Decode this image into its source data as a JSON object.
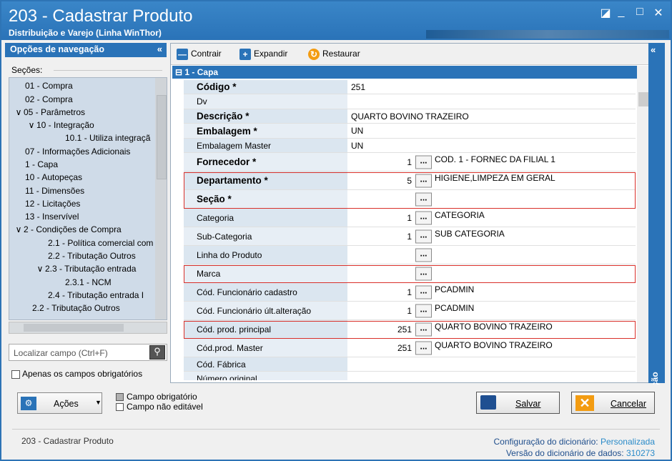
{
  "window": {
    "title": "203 - Cadastrar  Produto",
    "subtitle": "Distribuição e Varejo (Linha WinThor)",
    "controls": [
      "◪",
      "_",
      "□",
      "✕"
    ]
  },
  "nav": {
    "header": "Opções de navegação",
    "collapse": "«",
    "sections_label": "Seções:",
    "tree": [
      {
        "label": "01 - Compra",
        "expander": ""
      },
      {
        "label": "02 - Compra",
        "expander": ""
      },
      {
        "label": "05 - Parâmetros",
        "expander": "∨"
      },
      {
        "label": "10 - Integração",
        "expander": "∨"
      },
      {
        "label": "10.1 - Utiliza integraçã",
        "expander": ""
      },
      {
        "label": "07 - Informações Adicionais",
        "expander": ""
      },
      {
        "label": "1 - Capa",
        "expander": ""
      },
      {
        "label": "10 - Autopeças",
        "expander": ""
      },
      {
        "label": "11 - Dimensões",
        "expander": ""
      },
      {
        "label": "12 - Licitações",
        "expander": ""
      },
      {
        "label": "13 - Inservível",
        "expander": ""
      },
      {
        "label": "2 - Condições de Compra",
        "expander": "∨"
      },
      {
        "label": "2.1 - Política comercial com",
        "expander": ""
      },
      {
        "label": "2.2 - Tributação Outros",
        "expander": ""
      },
      {
        "label": "2.3 - Tributação entrada",
        "expander": "∨"
      },
      {
        "label": "2.3.1 - NCM",
        "expander": ""
      },
      {
        "label": "2.4 - Tributação entrada I",
        "expander": ""
      },
      {
        "label": "2.2 - Tributação Outros",
        "expander": ""
      }
    ],
    "find_placeholder": "Localizar campo (Ctrl+F)",
    "only_required": "Apenas os campos obrigatórios"
  },
  "toolbar": {
    "contrair": "Contrair",
    "expandir": "Expandir",
    "restaurar": "Restaurar",
    "panel_collapse": "«"
  },
  "section_title": "1 - Capa",
  "fields": [
    {
      "label": "Código *",
      "required": true,
      "value": "251",
      "type": "text"
    },
    {
      "label": "Dv",
      "required": false,
      "value": "",
      "type": "text"
    },
    {
      "label": "Descrição *",
      "required": true,
      "value": "QUARTO BOVINO TRAZEIRO",
      "type": "text"
    },
    {
      "label": "Embalagem *",
      "required": true,
      "value": "UN",
      "type": "text"
    },
    {
      "label": "Embalagem Master",
      "required": false,
      "value": "UN",
      "type": "text"
    },
    {
      "label": "Fornecedor *",
      "required": true,
      "code": "1",
      "desc": "COD. 1 - FORNEC DA FILIAL 1",
      "type": "lookup"
    },
    {
      "label": "Departamento *",
      "required": true,
      "code": "5",
      "desc": "HIGIENE,LIMPEZA EM GERAL",
      "type": "lookup"
    },
    {
      "label": "Seção *",
      "required": true,
      "code": "",
      "desc": "",
      "type": "lookup"
    },
    {
      "label": "Categoria",
      "required": false,
      "code": "1",
      "desc": "CATEGORIA",
      "type": "lookup"
    },
    {
      "label": "Sub-Categoria",
      "required": false,
      "code": "1",
      "desc": "SUB CATEGORIA",
      "type": "lookup"
    },
    {
      "label": "Linha do Produto",
      "required": false,
      "code": "",
      "desc": "",
      "type": "lookup"
    },
    {
      "label": "Marca",
      "required": false,
      "code": "",
      "desc": "",
      "type": "lookup"
    },
    {
      "label": "Cód. Funcionário cadastro",
      "required": false,
      "code": "1",
      "desc": "PCADMIN",
      "type": "lookup"
    },
    {
      "label": "Cód. Funcionário últ.alteração",
      "required": false,
      "code": "1",
      "desc": "PCADMIN",
      "type": "lookup"
    },
    {
      "label": "Cód. prod. principal",
      "required": false,
      "code": "251",
      "desc": "QUARTO BOVINO TRAZEIRO",
      "type": "lookup"
    },
    {
      "label": "Cód.prod. Master",
      "required": false,
      "code": "251",
      "desc": "QUARTO BOVINO TRAZEIRO",
      "type": "lookup"
    },
    {
      "label": "Cód. Fábrica",
      "required": false,
      "value": "",
      "type": "text"
    },
    {
      "label": "Número original",
      "required": false,
      "value": "",
      "type": "text"
    }
  ],
  "ellipsis": "...",
  "info_panel": {
    "label": "Informação",
    "collapse": "«"
  },
  "bottom": {
    "acoes": "Ações",
    "legend_required": "Campo obrigatório",
    "legend_noneditable": "Campo não editável",
    "salvar": "Salvar",
    "cancelar": "Cancelar"
  },
  "footer": {
    "left": "203 - Cadastrar  Produto",
    "config_label": "Configuração do dicionário:",
    "config_value": "Personalizada",
    "version_label": "Versão do dicionário de dados:",
    "version_value": "310273"
  },
  "colors": {
    "accent": "#2a73b8",
    "highlight_border": "#d9302a",
    "warning": "#f39c12"
  }
}
